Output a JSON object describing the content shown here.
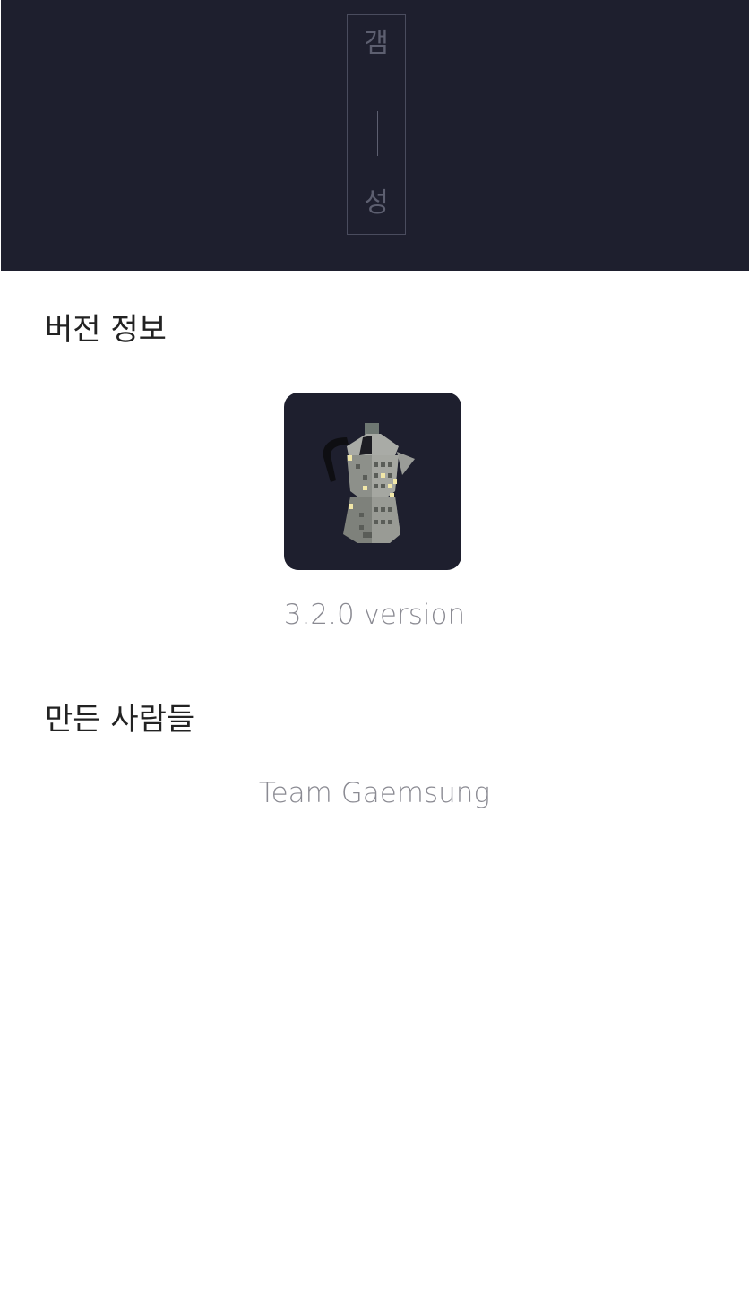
{
  "header": {
    "logo": {
      "top_char": "갬",
      "bottom_char": "성",
      "icon": "vertical-bar-icon"
    },
    "background_color": "#1e1f2e"
  },
  "version_section": {
    "title": "버전 정보",
    "app_icon": "moka-pot-building-icon",
    "version_text": "3.2.0 version"
  },
  "makers_section": {
    "title": "만든 사람들",
    "team_text": "Team Gaemsung"
  }
}
